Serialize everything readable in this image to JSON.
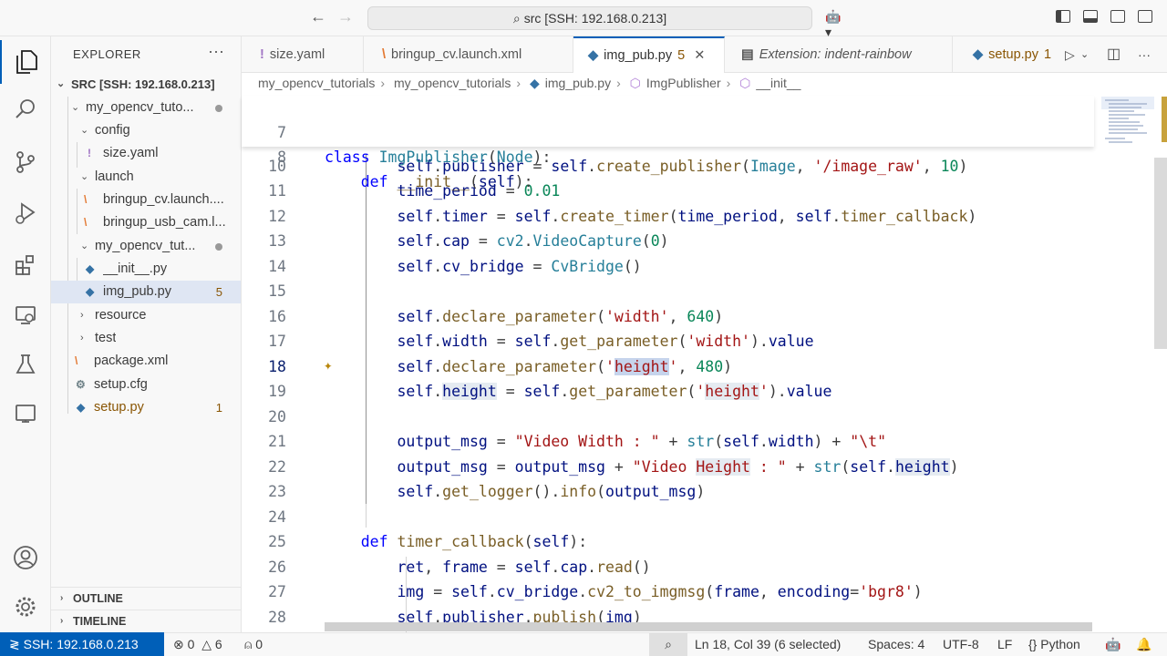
{
  "title_bar": {
    "search_text": "src [SSH: 192.168.0.213]"
  },
  "explorer": {
    "title": "EXPLORER",
    "root": "SRC [SSH: 192.168.0.213]",
    "items": [
      {
        "label": "my_opencv_tuto..."
      },
      {
        "label": "config"
      },
      {
        "label": "size.yaml",
        "icon": "!"
      },
      {
        "label": "launch"
      },
      {
        "label": "bringup_cv.launch...."
      },
      {
        "label": "bringup_usb_cam.l..."
      },
      {
        "label": "my_opencv_tut..."
      },
      {
        "label": "__init__.py"
      },
      {
        "label": "img_pub.py",
        "badge": "5"
      },
      {
        "label": "resource"
      },
      {
        "label": "test"
      },
      {
        "label": "package.xml"
      },
      {
        "label": "setup.cfg"
      },
      {
        "label": "setup.py",
        "badge": "1"
      }
    ],
    "outline": "OUTLINE",
    "timeline": "TIMELINE"
  },
  "tabs": [
    {
      "label": "size.yaml",
      "icon": "!"
    },
    {
      "label": "bringup_cv.launch.xml"
    },
    {
      "label": "img_pub.py",
      "badge": "5",
      "active": true
    },
    {
      "label": "Extension: indent-rainbow"
    },
    {
      "label": "setup.py",
      "badge": "1"
    }
  ],
  "breadcrumb": [
    "my_opencv_tutorials",
    "my_opencv_tutorials",
    "img_pub.py",
    "ImgPublisher",
    "__init__"
  ],
  "sticky": [
    {
      "num": "7",
      "text": "class ImgPublisher(Node):"
    },
    {
      "num": "8",
      "text": "    def __init__(self):"
    }
  ],
  "code_lines": [
    {
      "num": "10"
    },
    {
      "num": "11"
    },
    {
      "num": "12"
    },
    {
      "num": "13"
    },
    {
      "num": "14"
    },
    {
      "num": "15"
    },
    {
      "num": "16"
    },
    {
      "num": "17"
    },
    {
      "num": "18"
    },
    {
      "num": "19"
    },
    {
      "num": "20"
    },
    {
      "num": "21"
    },
    {
      "num": "22"
    },
    {
      "num": "23"
    },
    {
      "num": "24"
    },
    {
      "num": "25"
    },
    {
      "num": "26"
    },
    {
      "num": "27"
    },
    {
      "num": "28"
    }
  ],
  "code_text": {
    "l7a": "class",
    "l7b": "ImgPublisher",
    "l7c": "Node",
    "l8a": "def",
    "l8b": "__init__",
    "l8c": "self",
    "image_raw": "'/image_raw'",
    "n10": "10",
    "n001": "0.01",
    "n0": "0",
    "width": "'width'",
    "n640": "640",
    "height": "'height'",
    "n480": "480",
    "vw": "\"Video Width : \"",
    "tab": "\"\\t\"",
    "vh": "\"Video Height : \"",
    "bgr8": "'bgr8'"
  },
  "status_bar": {
    "remote": "SSH: 192.168.0.213",
    "errors": "0",
    "warnings": "6",
    "ports": "0",
    "position": "Ln 18, Col 39 (6 selected)",
    "spaces": "Spaces: 4",
    "encoding": "UTF-8",
    "eol": "LF",
    "language": "Python"
  },
  "colors": {
    "accent": "#005fb8",
    "keyword": "#0000ff",
    "string": "#a31515",
    "number": "#098658",
    "class": "#267f99"
  }
}
